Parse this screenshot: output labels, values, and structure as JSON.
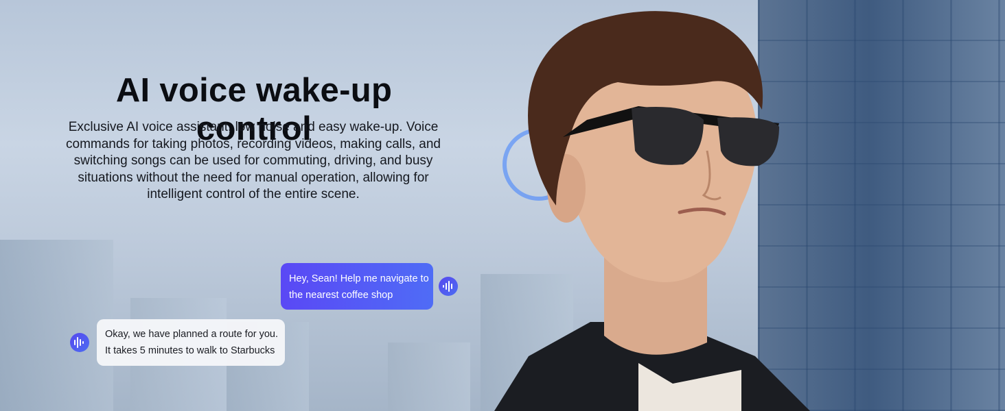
{
  "headline": "AI voice wake-up control",
  "description": "Exclusive AI voice assistant, low noise and easy wake-up. Voice commands for taking photos, recording videos, making calls, and switching songs can be used for commuting, driving, and busy situations without the need for manual operation, allowing for intelligent control of the entire scene.",
  "chat": {
    "user_message": {
      "line1": "Hey, Sean! Help me navigate to",
      "line2": "the nearest coffee shop",
      "icon": "voice-wave-icon"
    },
    "assistant_reply": {
      "line1": "Okay, we have planned a route for you.",
      "line2": "It takes 5 minutes to walk to Starbucks",
      "icon": "voice-wave-icon"
    }
  },
  "colors": {
    "user_bubble_start": "#5a48f5",
    "user_bubble_end": "#4f6cf6",
    "assistant_bubble": "#f5f6f9",
    "headline_text": "#0b0d12"
  }
}
